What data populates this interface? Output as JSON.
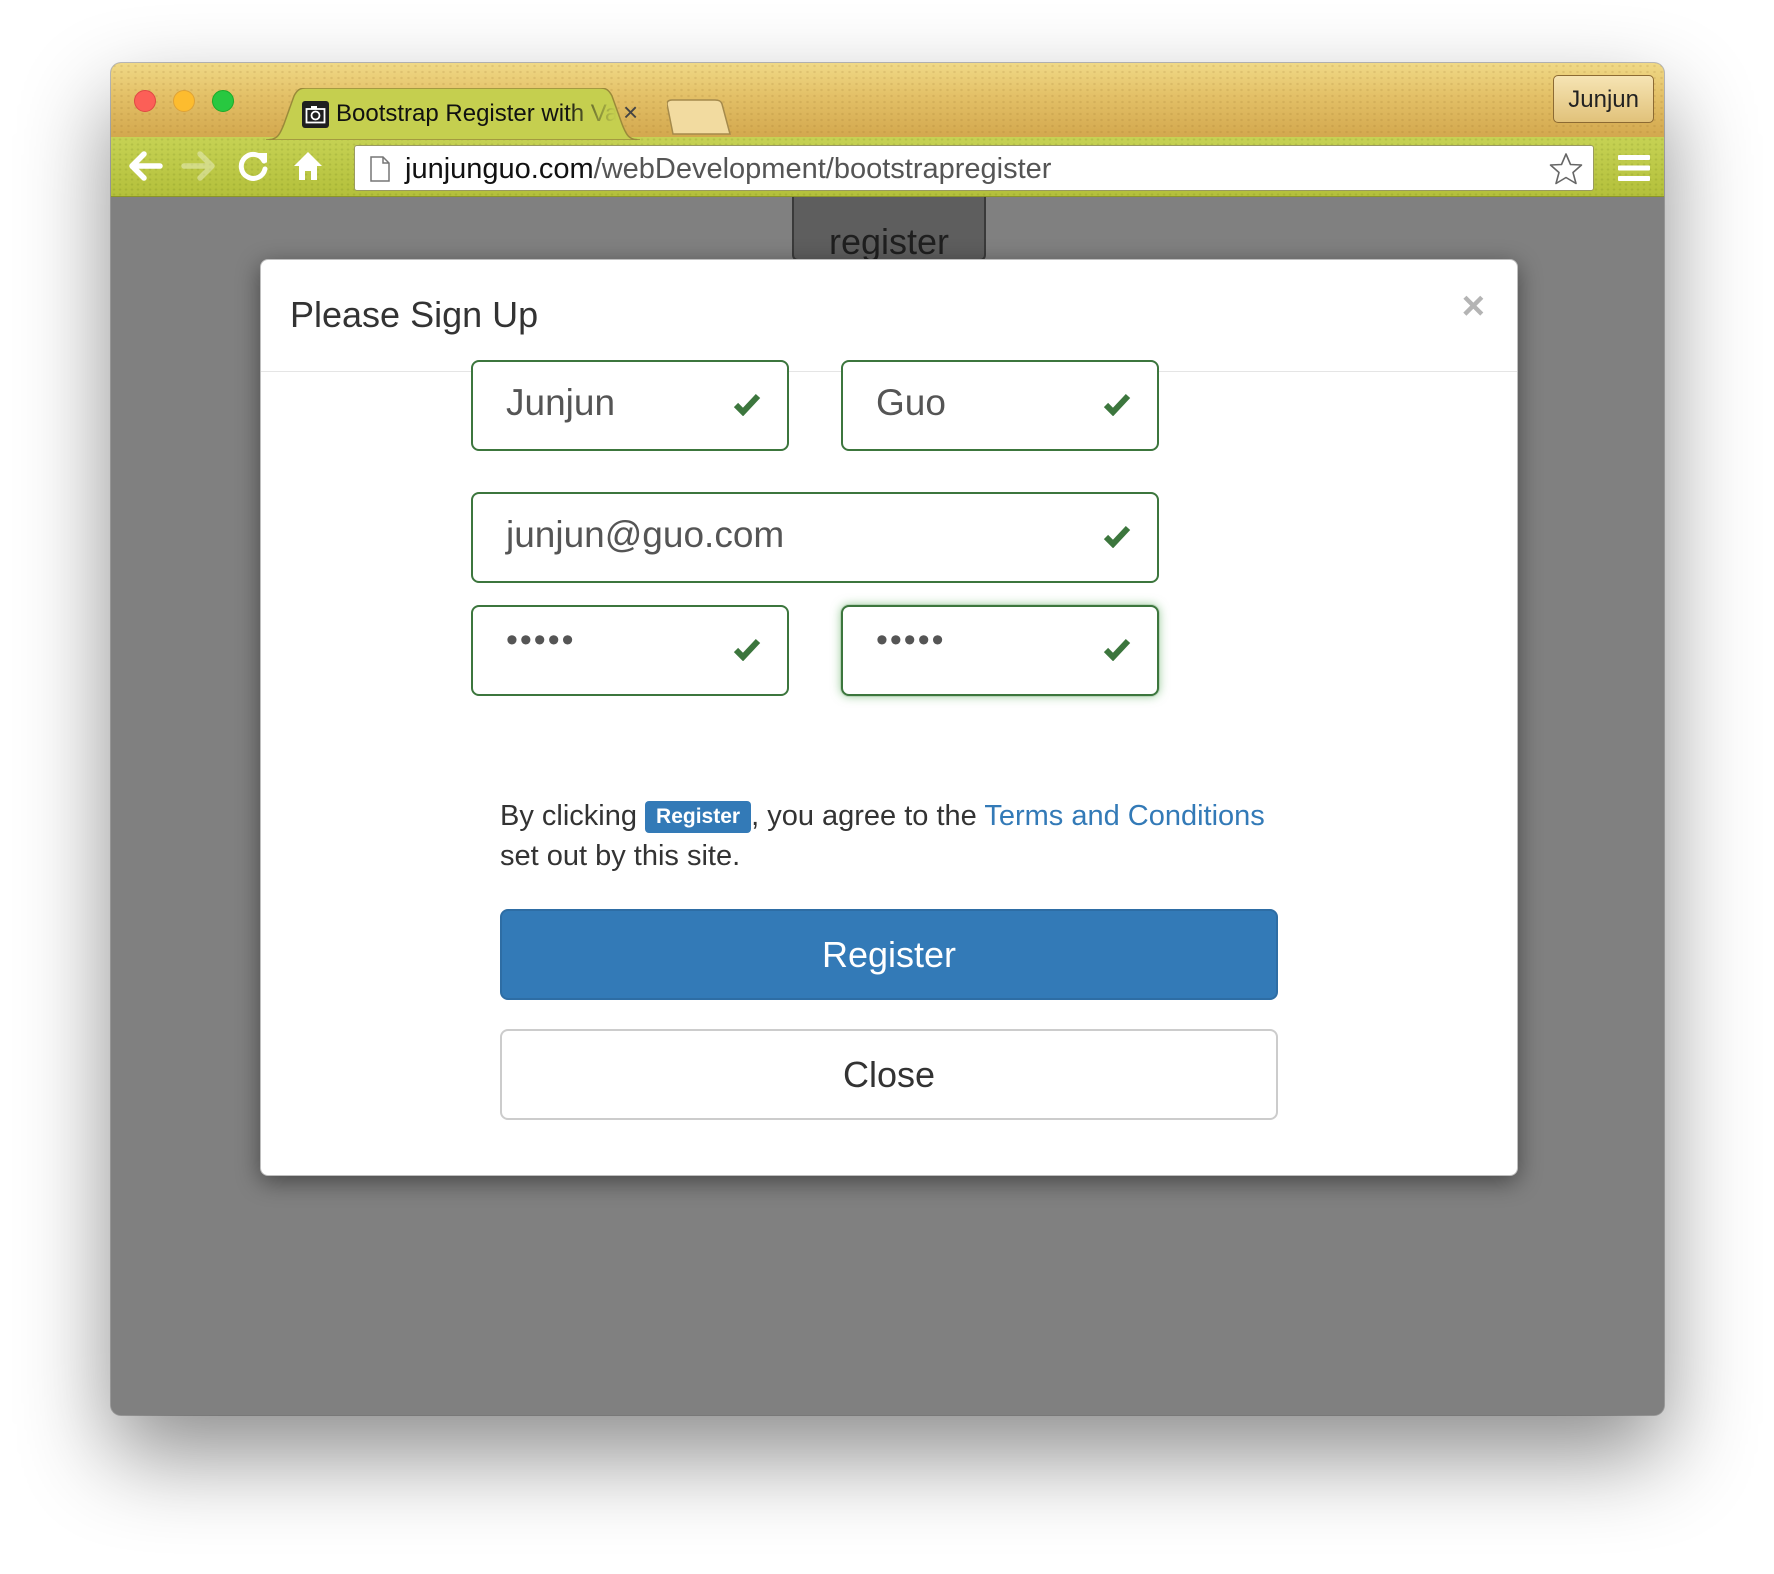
{
  "browser": {
    "tab_title": "Bootstrap Register with Validation",
    "tab_close": "×",
    "user_button": "Junjun",
    "url_domain": "junjunguo.com",
    "url_path": "/webDevelopment/bootstrapregister"
  },
  "page": {
    "background_button": "register"
  },
  "modal": {
    "title": "Please Sign Up",
    "close_x": "×",
    "first_name": "Junjun",
    "last_name": "Guo",
    "email": "junjun@guo.com",
    "password_mask": "•••••",
    "confirm_password_mask": "•••••",
    "agree_prefix": "By clicking ",
    "agree_label": "Register",
    "agree_middle": ", you agree to the ",
    "agree_link": "Terms and Conditions",
    "agree_suffix": " set out by this site.",
    "register_button": "Register",
    "close_button": "Close"
  },
  "colors": {
    "primary": "#337ab7",
    "success": "#3c763d",
    "backdrop": "#808080"
  }
}
